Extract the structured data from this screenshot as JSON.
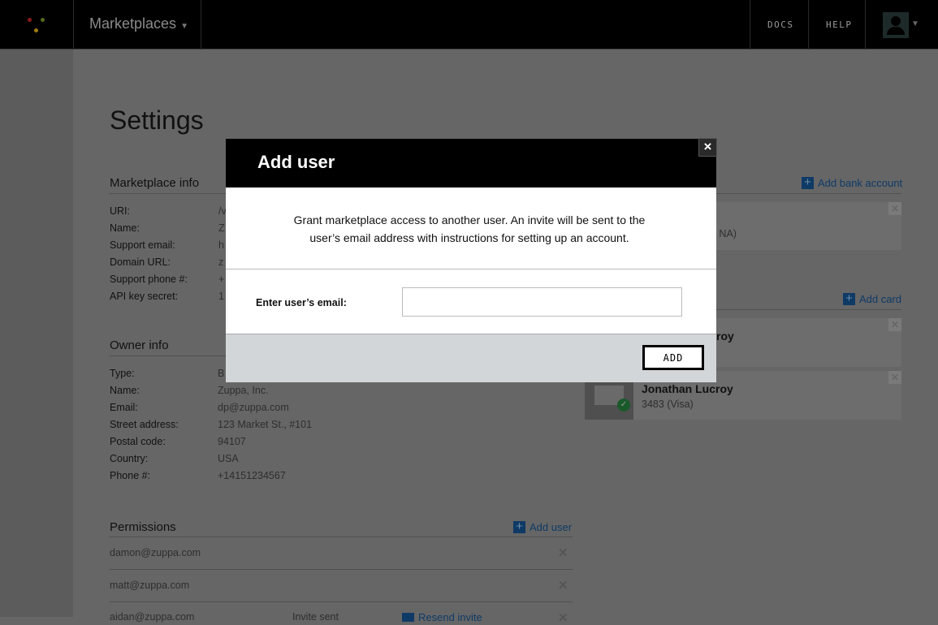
{
  "topbar": {
    "app_menu": "Marketplaces",
    "docs": "DOCS",
    "help": "HELP",
    "logo_colors": [
      "#8b1a1a",
      "#556b1a",
      "#a07a10"
    ]
  },
  "page": {
    "title": "Settings"
  },
  "marketplace_info": {
    "title": "Marketplace info",
    "rows": [
      {
        "label": "URI:",
        "value": "/v"
      },
      {
        "label": "Name:",
        "value": "Z"
      },
      {
        "label": "Support email:",
        "value": "h"
      },
      {
        "label": "Domain URL:",
        "value": "z"
      },
      {
        "label": "Support phone #:",
        "value": "+"
      },
      {
        "label": "API key secret:",
        "value": "1"
      }
    ]
  },
  "owner_info": {
    "title": "Owner info",
    "rows": [
      {
        "label": "Type:",
        "value": "B"
      },
      {
        "label": "Name:",
        "value": "Zuppa, Inc."
      },
      {
        "label": "Email:",
        "value": "dp@zuppa.com"
      },
      {
        "label": "Street address:",
        "value": "123 Market St., #101"
      },
      {
        "label": "Postal code:",
        "value": "94107"
      },
      {
        "label": "Country:",
        "value": "USA"
      },
      {
        "label": "Phone #:",
        "value": "+14151234567"
      }
    ]
  },
  "permissions": {
    "title": "Permissions",
    "add_label": "Add user",
    "users": [
      {
        "email": "damon@zuppa.com"
      },
      {
        "email": "matt@zuppa.com"
      },
      {
        "email": "aidan@zuppa.com",
        "status": "Invite sent",
        "action": "Resend invite"
      }
    ]
  },
  "bank": {
    "add_label": "Add bank account",
    "account_fragment": "o NA)"
  },
  "cards": {
    "add_label": "Add card",
    "items": [
      {
        "name_fragment": "roy"
      },
      {
        "name": "Jonathan Lucroy",
        "detail": "3483 (Visa)"
      }
    ]
  },
  "modal": {
    "title": "Add user",
    "description": "Grant marketplace access to another user. An invite will be sent to the user’s email address with instructions for setting up an account.",
    "email_label": "Enter user’s email:",
    "email_value": "",
    "submit": "ADD",
    "close": "×"
  }
}
